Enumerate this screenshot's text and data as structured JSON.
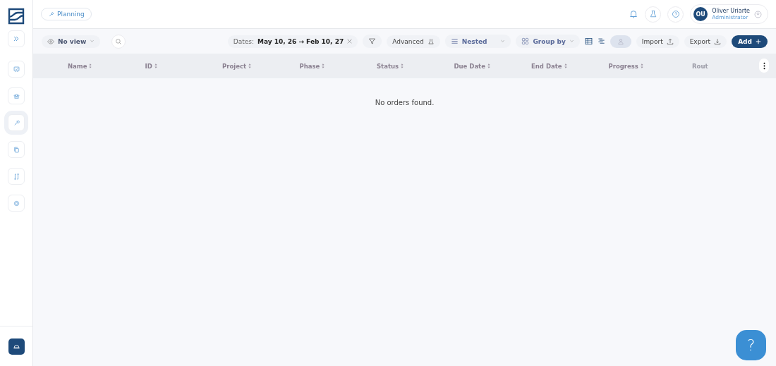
{
  "sidebar": {
    "items": [
      {
        "selected": false
      },
      {
        "selected": false
      },
      {
        "selected": true
      },
      {
        "selected": false
      },
      {
        "selected": false
      },
      {
        "selected": false
      }
    ]
  },
  "breadcrumb": {
    "label": "Planning"
  },
  "user": {
    "initials": "OU",
    "name": "Oliver Uriarte",
    "role": "Administrator"
  },
  "toolbar": {
    "view": "No view",
    "dates_label": "Dates:",
    "dates_value": "May 10, 26 → Feb 10, 27",
    "advanced": "Advanced",
    "nested": "Nested",
    "group_by": "Group by",
    "import": "Import",
    "export": "Export",
    "add": "Add"
  },
  "table": {
    "columns": [
      "Name",
      "ID",
      "Project",
      "Phase",
      "Status",
      "Due Date",
      "End Date",
      "Progress"
    ],
    "column_9": "Rout",
    "empty_message": "No orders found."
  },
  "help": {
    "label": "?"
  }
}
